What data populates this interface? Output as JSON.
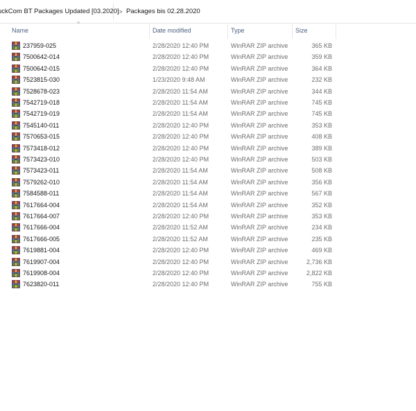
{
  "breadcrumb": {
    "parent": "uckCom BT Packages Updated [03.2020]",
    "separator": ">",
    "current": "Packages bis 02.28.2020"
  },
  "columns": {
    "name": "Name",
    "date": "Date modified",
    "type": "Type",
    "size": "Size"
  },
  "sort_indicator": "^",
  "icon": "winrar-archive-icon",
  "files": [
    {
      "name": "237959-025",
      "date": "2/28/2020 12:40 PM",
      "type": "WinRAR ZIP archive",
      "size": "365 KB"
    },
    {
      "name": "7500642-014",
      "date": "2/28/2020 12:40 PM",
      "type": "WinRAR ZIP archive",
      "size": "359 KB"
    },
    {
      "name": "7500642-015",
      "date": "2/28/2020 12:40 PM",
      "type": "WinRAR ZIP archive",
      "size": "364 KB"
    },
    {
      "name": "7523815-030",
      "date": "1/23/2020 9:48 AM",
      "type": "WinRAR ZIP archive",
      "size": "232 KB"
    },
    {
      "name": "7528678-023",
      "date": "2/28/2020 11:54 AM",
      "type": "WinRAR ZIP archive",
      "size": "344 KB"
    },
    {
      "name": "7542719-018",
      "date": "2/28/2020 11:54 AM",
      "type": "WinRAR ZIP archive",
      "size": "745 KB"
    },
    {
      "name": "7542719-019",
      "date": "2/28/2020 11:54 AM",
      "type": "WinRAR ZIP archive",
      "size": "745 KB"
    },
    {
      "name": "7545140-011",
      "date": "2/28/2020 12:40 PM",
      "type": "WinRAR ZIP archive",
      "size": "353 KB"
    },
    {
      "name": "7570653-015",
      "date": "2/28/2020 12:40 PM",
      "type": "WinRAR ZIP archive",
      "size": "408 KB"
    },
    {
      "name": "7573418-012",
      "date": "2/28/2020 12:40 PM",
      "type": "WinRAR ZIP archive",
      "size": "389 KB"
    },
    {
      "name": "7573423-010",
      "date": "2/28/2020 12:40 PM",
      "type": "WinRAR ZIP archive",
      "size": "503 KB"
    },
    {
      "name": "7573423-011",
      "date": "2/28/2020 11:54 AM",
      "type": "WinRAR ZIP archive",
      "size": "508 KB"
    },
    {
      "name": "7579262-010",
      "date": "2/28/2020 11:54 AM",
      "type": "WinRAR ZIP archive",
      "size": "356 KB"
    },
    {
      "name": "7584588-011",
      "date": "2/28/2020 11:54 AM",
      "type": "WinRAR ZIP archive",
      "size": "567 KB"
    },
    {
      "name": "7617664-004",
      "date": "2/28/2020 11:54 AM",
      "type": "WinRAR ZIP archive",
      "size": "352 KB"
    },
    {
      "name": "7617664-007",
      "date": "2/28/2020 12:40 PM",
      "type": "WinRAR ZIP archive",
      "size": "353 KB"
    },
    {
      "name": "7617666-004",
      "date": "2/28/2020 11:52 AM",
      "type": "WinRAR ZIP archive",
      "size": "234 KB"
    },
    {
      "name": "7617666-005",
      "date": "2/28/2020 11:52 AM",
      "type": "WinRAR ZIP archive",
      "size": "235 KB"
    },
    {
      "name": "7619881-004",
      "date": "2/28/2020 12:40 PM",
      "type": "WinRAR ZIP archive",
      "size": "469 KB"
    },
    {
      "name": "7619907-004",
      "date": "2/28/2020 12:40 PM",
      "type": "WinRAR ZIP archive",
      "size": "2,736 KB"
    },
    {
      "name": "7619908-004",
      "date": "2/28/2020 12:40 PM",
      "type": "WinRAR ZIP archive",
      "size": "2,822 KB"
    },
    {
      "name": "7623820-011",
      "date": "2/28/2020 12:40 PM",
      "type": "WinRAR ZIP archive",
      "size": "755 KB"
    }
  ]
}
